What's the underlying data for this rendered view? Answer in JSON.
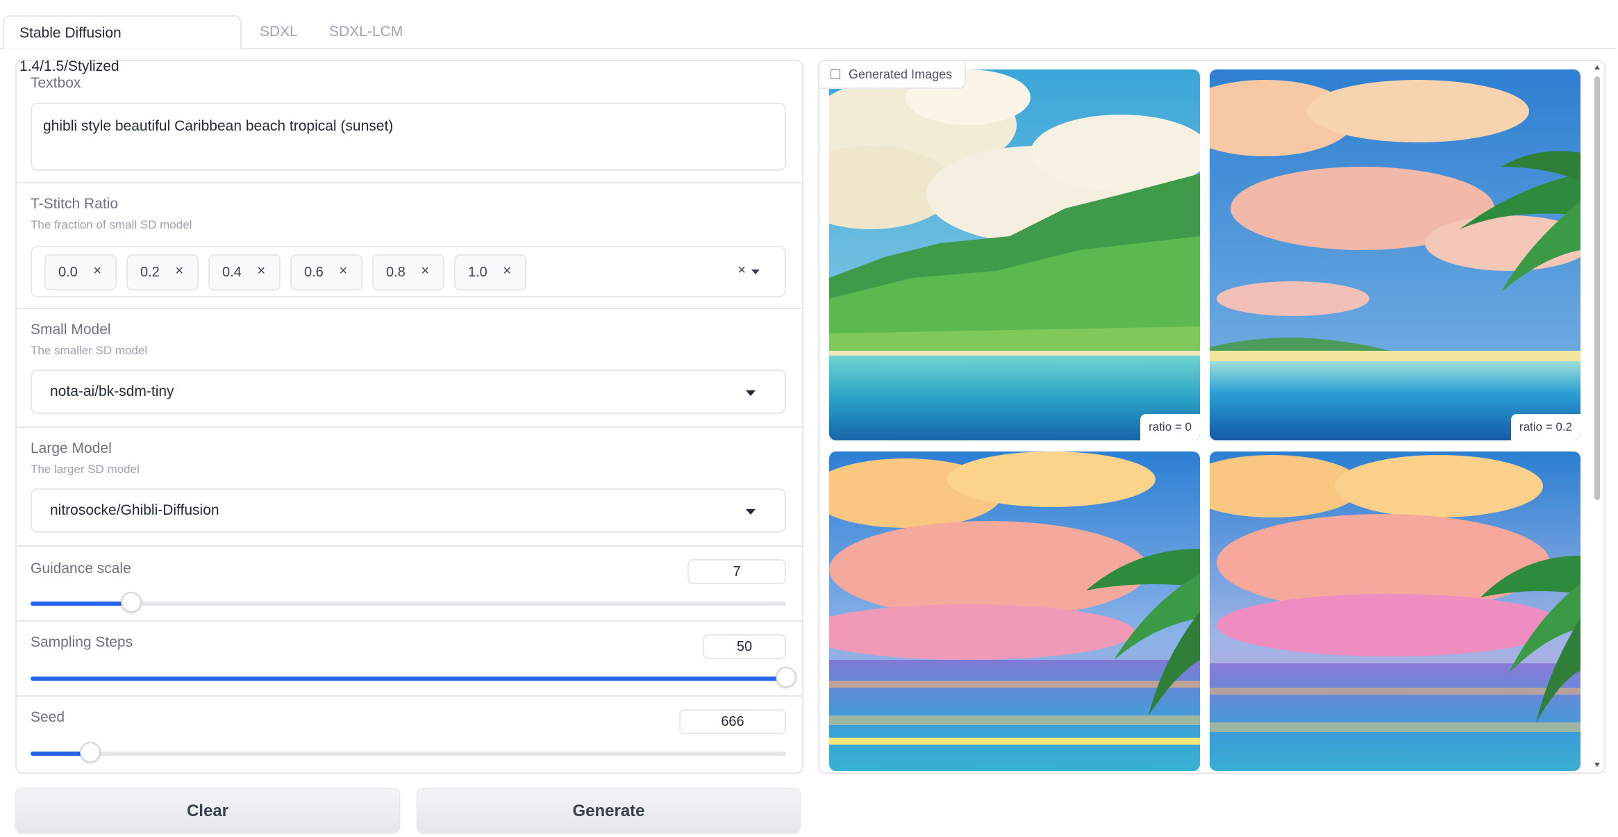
{
  "tabs": [
    {
      "label": "Stable Diffusion 1.4/1.5/Stylized",
      "active": true
    },
    {
      "label": "SDXL",
      "active": false
    },
    {
      "label": "SDXL-LCM",
      "active": false
    }
  ],
  "textbox": {
    "label": "Textbox",
    "value": "ghibli style beautiful Caribbean beach tropical (sunset)"
  },
  "tstitch": {
    "label": "T-Stitch Ratio",
    "info": "The fraction of small SD model",
    "chips": [
      "0.0",
      "0.2",
      "0.4",
      "0.6",
      "0.8",
      "1.0"
    ],
    "clear_glyph": "×",
    "chip_remove_glyph": "×"
  },
  "small_model": {
    "label": "Small Model",
    "info": "The smaller SD model",
    "value": "nota-ai/bk-sdm-tiny"
  },
  "large_model": {
    "label": "Large Model",
    "info": "The larger SD model",
    "value": "nitrosocke/Ghibli-Diffusion"
  },
  "guidance": {
    "label": "Guidance scale",
    "value": "7",
    "fraction": 0.133
  },
  "steps": {
    "label": "Sampling Steps",
    "value": "50",
    "fraction": 1.0
  },
  "seed": {
    "label": "Seed",
    "value": "666",
    "fraction": 0.079
  },
  "buttons": {
    "clear": "Clear",
    "generate": "Generate"
  },
  "gallery": {
    "label": "Generated Images",
    "images": [
      {
        "caption": "ratio = 0"
      },
      {
        "caption": "ratio = 0.2"
      },
      {
        "caption": ""
      },
      {
        "caption": ""
      }
    ]
  },
  "colors": {
    "accent": "#2563eb",
    "border": "#e5e7eb"
  }
}
